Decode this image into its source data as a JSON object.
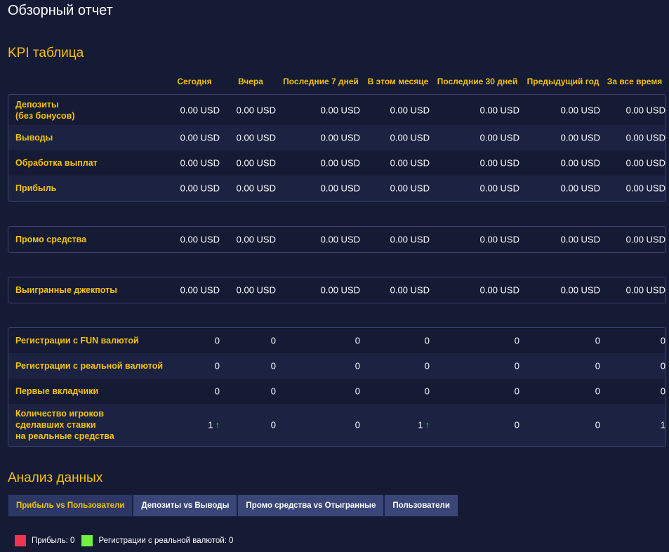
{
  "page_title": "Обзорный отчет",
  "kpi_title": "KPI таблица",
  "columns": [
    "Сегодня",
    "Вчера",
    "Последние 7 дней",
    "В этом месяце",
    "Последние 30 дней",
    "Предыдущий год",
    "За все время"
  ],
  "groups": [
    {
      "rows": [
        {
          "label": "Депозиты\n(без бонусов)",
          "values": [
            "0.00 USD",
            "0.00 USD",
            "0.00 USD",
            "0.00 USD",
            "0.00 USD",
            "0.00 USD",
            "0.00 USD"
          ]
        },
        {
          "label": "Выводы",
          "values": [
            "0.00 USD",
            "0.00 USD",
            "0.00 USD",
            "0.00 USD",
            "0.00 USD",
            "0.00 USD",
            "0.00 USD"
          ]
        },
        {
          "label": "Обработка выплат",
          "values": [
            "0.00 USD",
            "0.00 USD",
            "0.00 USD",
            "0.00 USD",
            "0.00 USD",
            "0.00 USD",
            "0.00 USD"
          ]
        },
        {
          "label": "Прибыль",
          "values": [
            "0.00 USD",
            "0.00 USD",
            "0.00 USD",
            "0.00 USD",
            "0.00 USD",
            "0.00 USD",
            "0.00 USD"
          ]
        }
      ]
    },
    {
      "rows": [
        {
          "label": "Промо средства",
          "values": [
            "0.00 USD",
            "0.00 USD",
            "0.00 USD",
            "0.00 USD",
            "0.00 USD",
            "0.00 USD",
            "0.00 USD"
          ]
        }
      ]
    },
    {
      "rows": [
        {
          "label": "Выигранные джекпоты",
          "values": [
            "0.00 USD",
            "0.00 USD",
            "0.00 USD",
            "0.00 USD",
            "0.00 USD",
            "0.00 USD",
            "0.00 USD"
          ]
        }
      ]
    },
    {
      "rows": [
        {
          "label": "Регистрации с FUN валютой",
          "values": [
            "0",
            "0",
            "0",
            "0",
            "0",
            "0",
            "0"
          ]
        },
        {
          "label": "Регистрации с реальной валютой",
          "values": [
            "0",
            "0",
            "0",
            "0",
            "0",
            "0",
            "0"
          ]
        },
        {
          "label": "Первые вкладчики",
          "values": [
            "0",
            "0",
            "0",
            "0",
            "0",
            "0",
            "0"
          ]
        },
        {
          "label": "Количество игроков\nсделавших ставки\nна реальные средства",
          "values": [
            "1",
            "0",
            "0",
            "1",
            "0",
            "0",
            "1"
          ],
          "up": [
            true,
            false,
            false,
            true,
            false,
            false,
            false
          ]
        }
      ]
    }
  ],
  "analysis_title": "Анализ данных",
  "tabs": [
    {
      "label": "Прибыль vs Пользователи",
      "active": true
    },
    {
      "label": "Депозиты vs Выводы",
      "active": false
    },
    {
      "label": "Промо средства vs Отыгранные",
      "active": false
    },
    {
      "label": "Пользователи",
      "active": false
    }
  ],
  "legend": [
    {
      "label": "Прибыль: 0",
      "color": "#f0334f"
    },
    {
      "label": "Регистрации с реальной валютой: 0",
      "color": "#6ef33f"
    }
  ],
  "up_arrow": "↑"
}
